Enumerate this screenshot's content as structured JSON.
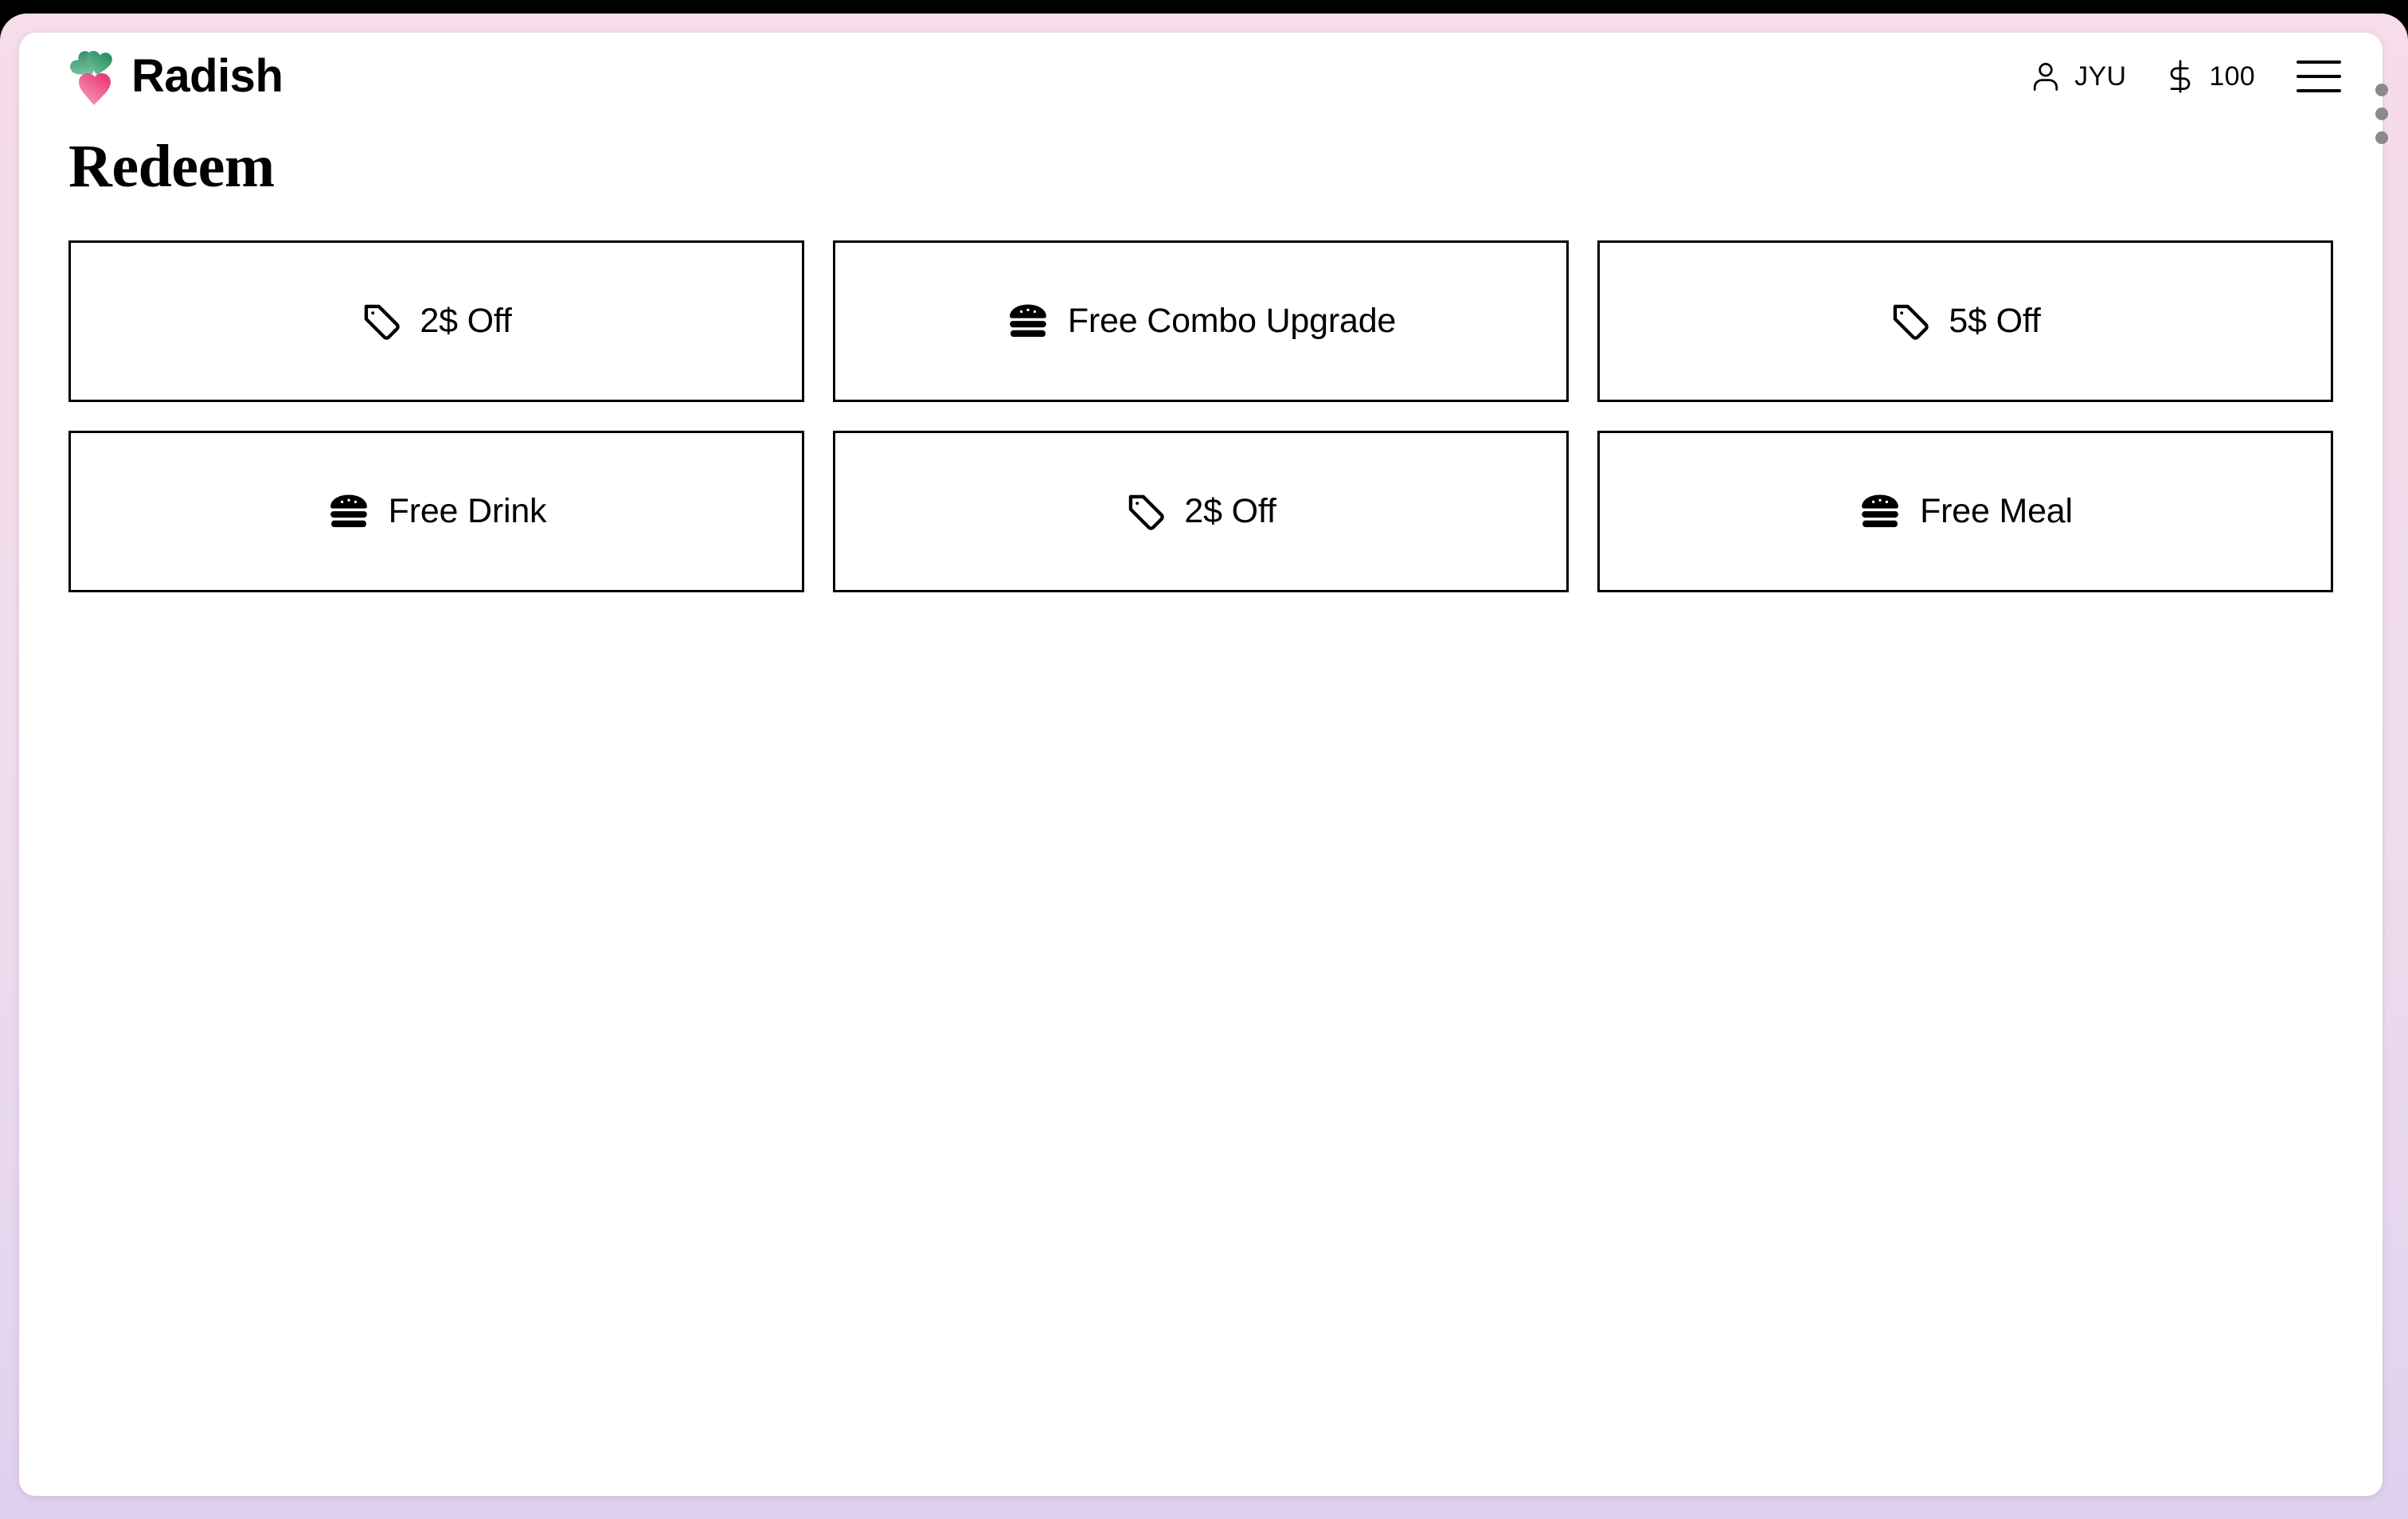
{
  "frame": {
    "handle_dots": 3,
    "frame_gradient_top": "#f7dcea",
    "frame_gradient_bottom": "#ded0ee",
    "top_bar_color": "#000000"
  },
  "header": {
    "brand_name": "Radish",
    "logo_icon": "radish-logo-icon",
    "logo_leaf_color": "#3f9a72",
    "logo_root_color": "#ef4f86",
    "account": {
      "icon": "user-icon",
      "label": "JYU"
    },
    "balance": {
      "icon": "dollar-icon",
      "label": "100"
    },
    "menu": {
      "icon": "hamburger-menu-icon",
      "label": "Menu"
    }
  },
  "main": {
    "title": "Redeem",
    "rewards": [
      {
        "icon": "price-tag-icon",
        "label": "2$ Off"
      },
      {
        "icon": "burger-icon",
        "label": "Free Combo Upgrade"
      },
      {
        "icon": "price-tag-icon",
        "label": "5$ Off"
      },
      {
        "icon": "burger-icon",
        "label": "Free Drink"
      },
      {
        "icon": "price-tag-icon",
        "label": "2$ Off"
      },
      {
        "icon": "burger-icon",
        "label": "Free Meal"
      }
    ]
  }
}
